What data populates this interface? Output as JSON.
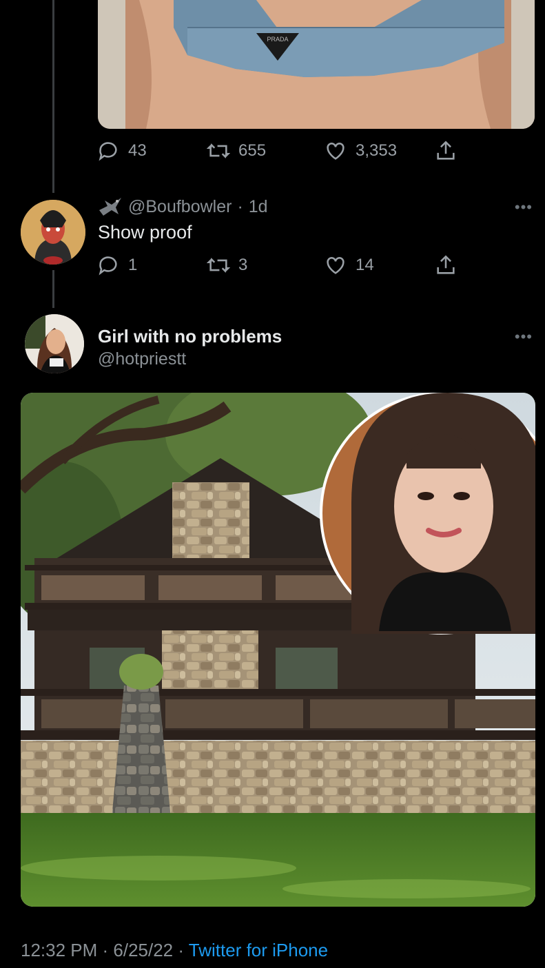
{
  "reply_tweet_1": {
    "actions": {
      "replies": "43",
      "retweets": "655",
      "likes": "3,353"
    },
    "media_text": "PRADA"
  },
  "reply_tweet_2": {
    "handle": "@Boufbowler",
    "time": "1d",
    "separator": "·",
    "text": "Show proof",
    "actions": {
      "replies": "1",
      "retweets": "3",
      "likes": "14"
    }
  },
  "main_tweet": {
    "display_name": "Girl with no problems",
    "handle": "@hotpriestt",
    "timestamp": "12:32 PM · 6/25/22 · ",
    "client": "Twitter for iPhone"
  },
  "icons": {
    "reply": "reply-icon",
    "retweet": "retweet-icon",
    "like": "heart-icon",
    "share": "share-icon",
    "more": "more-icon"
  },
  "colors": {
    "background": "#000000",
    "text": "#e7e9ea",
    "muted": "#8b9196",
    "link": "#1d9bf0"
  }
}
